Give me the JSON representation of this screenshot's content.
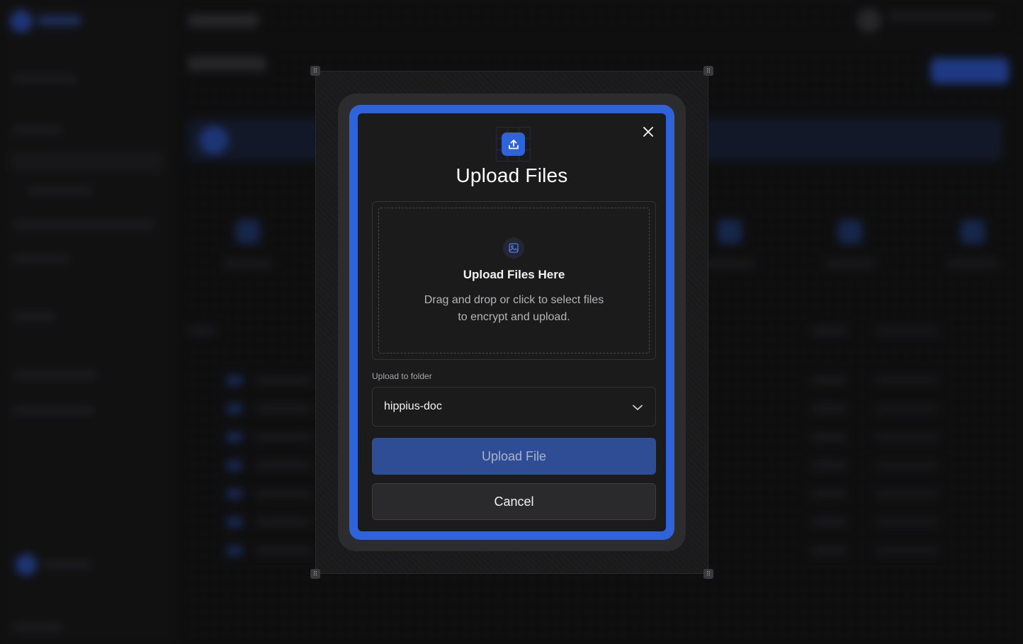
{
  "modal": {
    "title": "Upload Files",
    "close_icon": "close-icon",
    "header_icon": "upload-icon",
    "dropzone": {
      "icon": "image-icon",
      "title": "Upload Files Here",
      "description": "Drag and drop or click to select files to encrypt and upload."
    },
    "folder_select": {
      "label": "Upload to folder",
      "value": "hippius-doc"
    },
    "upload_button_label": "Upload File",
    "cancel_button_label": "Cancel"
  },
  "colors": {
    "accent": "#2f63d9",
    "upload_button_bg": "#2f4d95",
    "dialog_bg": "#1b1b1c",
    "page_bg": "#0f0f10"
  }
}
